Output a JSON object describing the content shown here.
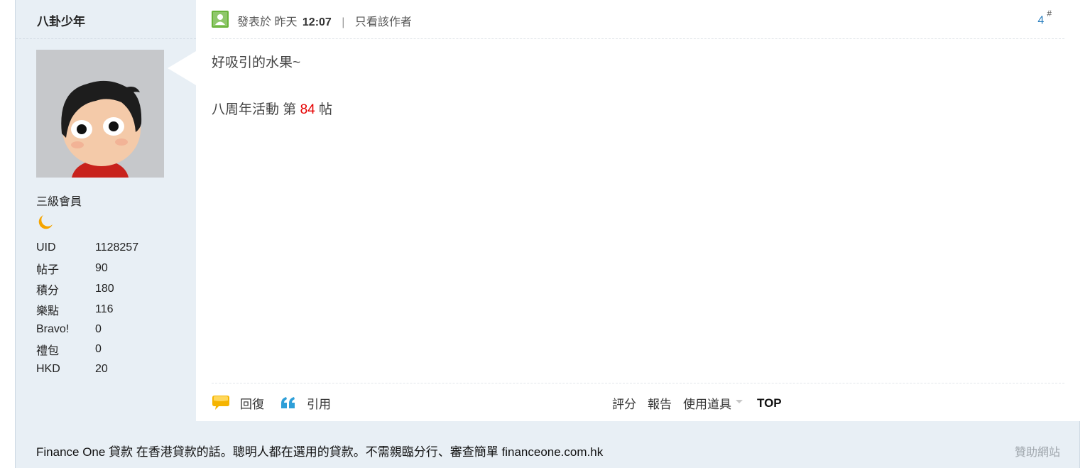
{
  "author": {
    "username": "八卦少年",
    "rank": "三級會員",
    "stats": [
      {
        "label": "UID",
        "value": "1128257"
      },
      {
        "label": "帖子",
        "value": "90"
      },
      {
        "label": "積分",
        "value": "180"
      },
      {
        "label": "樂點",
        "value": "116"
      },
      {
        "label": "Bravo!",
        "value": "0"
      },
      {
        "label": "禮包",
        "value": "0"
      },
      {
        "label": "HKD",
        "value": "20"
      }
    ]
  },
  "post": {
    "posted_prefix": "發表於 昨天",
    "posted_time": "12:07",
    "separator": "|",
    "only_author": "只看該作者",
    "floor_number": "4",
    "floor_mark": "#",
    "body_line1": "好吸引的水果~",
    "body_line2_prefix": "八周年活動 第 ",
    "body_line2_number": "84",
    "body_line2_suffix": " 帖"
  },
  "actions": {
    "reply": "回復",
    "quote": "引用",
    "rate": "評分",
    "report": "報告",
    "use_tools": "使用道具",
    "top": "TOP"
  },
  "ad": {
    "text": "Finance One 貸款 在香港貸款的話。聰明人都在選用的貸款。不需親臨分行、審查簡單 financeone.com.hk",
    "sponsor": "贊助網站"
  },
  "colors": {
    "sidebar_bg": "#e8eff5",
    "accent_blue": "#2b7fbf",
    "highlight_red": "#e60000",
    "user_icon_green": "#6ab43a"
  }
}
